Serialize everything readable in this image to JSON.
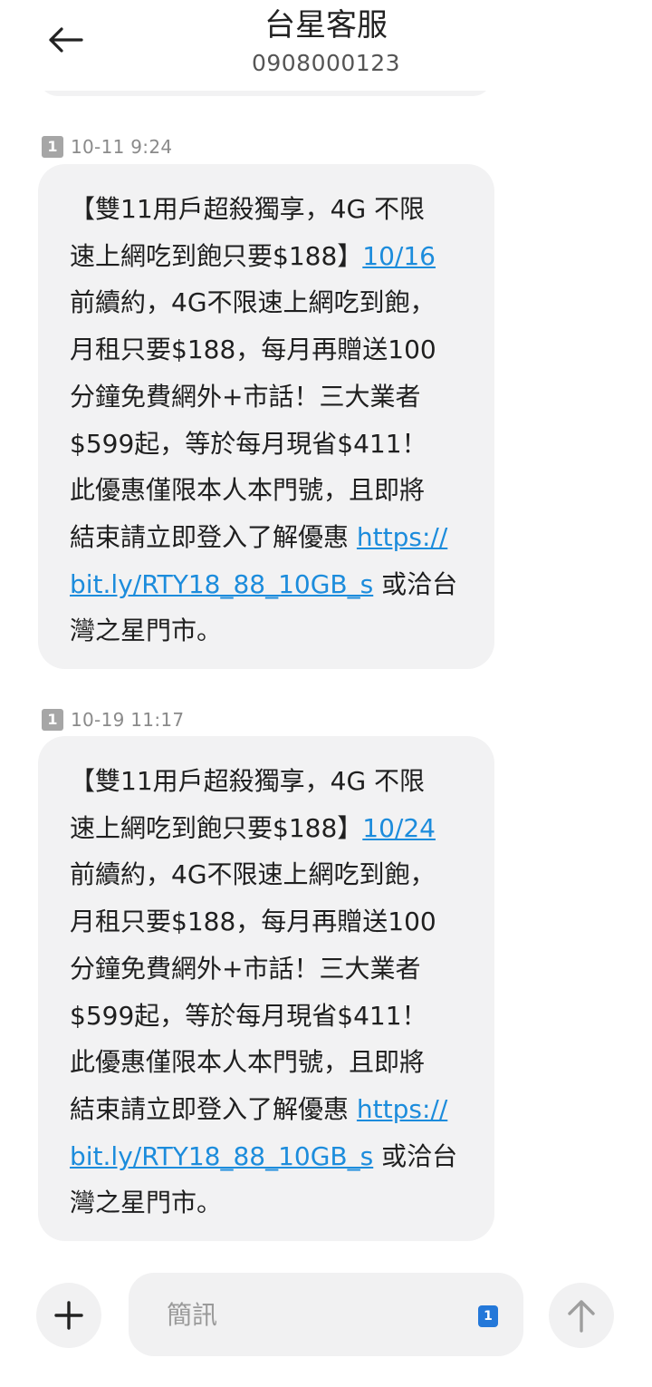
{
  "header": {
    "title": "台星客服",
    "phone": "0908000123"
  },
  "messages": [
    {
      "sim": "1",
      "time": "10-11 9:24",
      "lines": [
        [
          "【雙11用戶超殺獨享，4G 不限"
        ],
        [
          "速上網吃到飽只要$188】",
          "10/16"
        ],
        [
          "前續約，4G不限速上網吃到飽，"
        ],
        [
          "月租只要$188，每月再贈送100"
        ],
        [
          "分鐘免費網外+市話！三大業者"
        ],
        [
          "$599起，等於每月現省$411！"
        ],
        [
          "此優惠僅限本人本門號，且即將"
        ],
        [
          "結束請立即登入了解優惠 ",
          "https://"
        ],
        [
          "",
          "bit.ly/RTY18_88_10GB_s",
          " 或洽台"
        ],
        [
          "灣之星門市。"
        ]
      ]
    },
    {
      "sim": "1",
      "time": "10-19 11:17",
      "lines": [
        [
          "【雙11用戶超殺獨享，4G 不限"
        ],
        [
          "速上網吃到飽只要$188】",
          "10/24"
        ],
        [
          "前續約，4G不限速上網吃到飽，"
        ],
        [
          "月租只要$188，每月再贈送100"
        ],
        [
          "分鐘免費網外+市話！三大業者"
        ],
        [
          "$599起，等於每月現省$411！"
        ],
        [
          "此優惠僅限本人本門號，且即將"
        ],
        [
          "結束請立即登入了解優惠 ",
          "https://"
        ],
        [
          "",
          "bit.ly/RTY18_88_10GB_s",
          " 或洽台"
        ],
        [
          "灣之星門市。"
        ]
      ]
    }
  ],
  "composer": {
    "placeholder": "簡訊",
    "sim": "1"
  },
  "icons": {
    "back": "arrow-left-icon",
    "add": "plus-icon",
    "send": "arrow-up-icon"
  },
  "colors": {
    "bubble": "#f2f2f3",
    "link": "#1c8cdc",
    "sim_select": "#2478d9"
  }
}
